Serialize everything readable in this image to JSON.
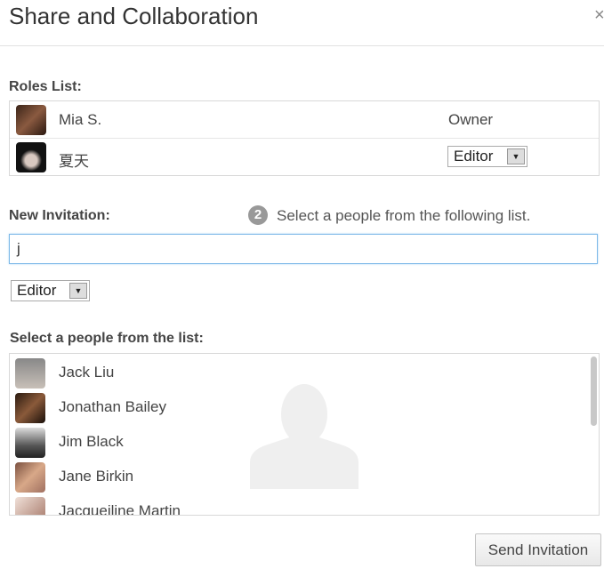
{
  "dialog": {
    "title": "Share and Collaboration",
    "close_icon": "close-icon"
  },
  "roles": {
    "label": "Roles List:",
    "items": [
      {
        "name": "Mia S.",
        "role": "Owner",
        "avatar_color": "#5a3a2a"
      },
      {
        "name": "夏天",
        "role": "Editor",
        "avatar_color": "#1e1e1e"
      }
    ]
  },
  "invitation": {
    "label": "New Invitation:",
    "step_number": "2",
    "hint": "Select a people from the following list.",
    "input_value": "j",
    "role_select": "Editor"
  },
  "people": {
    "label": "Select a people from the list:",
    "items": [
      {
        "name": "Jack Liu",
        "avatar_color": "#9a8a80"
      },
      {
        "name": "Jonathan Bailey",
        "avatar_color": "#4a2a1a"
      },
      {
        "name": "Jim Black",
        "avatar_color": "#6a6a6a"
      },
      {
        "name": "Jane Birkin",
        "avatar_color": "#b08060"
      },
      {
        "name": "Jacqueiline Martin",
        "avatar_color": "#c09080"
      }
    ]
  },
  "send_button": "Send Invitation"
}
